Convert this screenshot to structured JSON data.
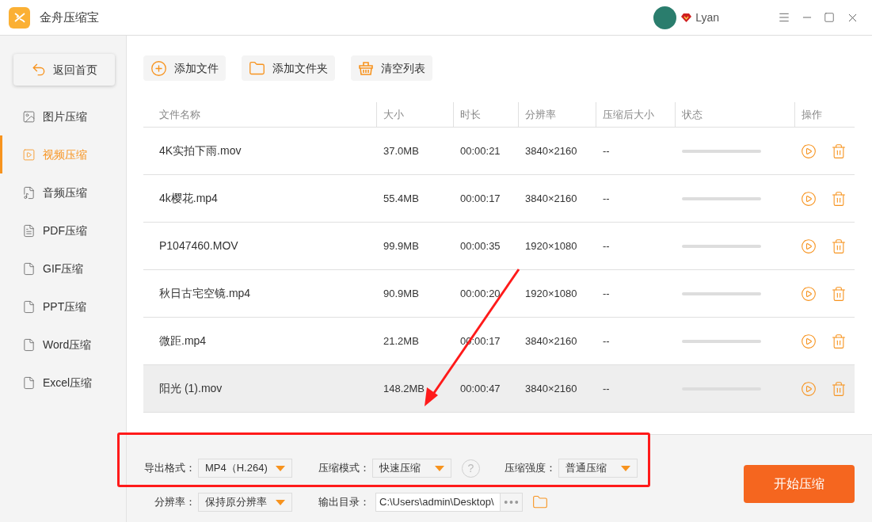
{
  "window": {
    "title": "金舟压缩宝",
    "user": "Lyan"
  },
  "sidebar": {
    "back_button": "返回首页",
    "items": [
      {
        "label": "图片压缩",
        "selected": false
      },
      {
        "label": "视频压缩",
        "selected": true
      },
      {
        "label": "音频压缩",
        "selected": false
      },
      {
        "label": "PDF压缩",
        "selected": false
      },
      {
        "label": "GIF压缩",
        "selected": false
      },
      {
        "label": "PPT压缩",
        "selected": false
      },
      {
        "label": "Word压缩",
        "selected": false
      },
      {
        "label": "Excel压缩",
        "selected": false
      }
    ]
  },
  "toolbar": [
    "添加文件",
    "添加文件夹",
    "清空列表"
  ],
  "table": {
    "columns": [
      "文件名称",
      "大小",
      "时长",
      "分辨率",
      "压缩后大小",
      "状态",
      "操作"
    ],
    "rows": [
      {
        "name": "4K实拍下雨.mov",
        "size": "37.0MB",
        "duration": "00:00:21",
        "resolution": "3840×2160",
        "compressed_size": "--",
        "selected": false
      },
      {
        "name": "4k樱花.mp4",
        "size": "55.4MB",
        "duration": "00:00:17",
        "resolution": "3840×2160",
        "compressed_size": "--",
        "selected": false
      },
      {
        "name": "P1047460.MOV",
        "size": "99.9MB",
        "duration": "00:00:35",
        "resolution": "1920×1080",
        "compressed_size": "--",
        "selected": false
      },
      {
        "name": "秋日古宅空镜.mp4",
        "size": "90.9MB",
        "duration": "00:00:20",
        "resolution": "1920×1080",
        "compressed_size": "--",
        "selected": false
      },
      {
        "name": "微距.mp4",
        "size": "21.2MB",
        "duration": "00:00:17",
        "resolution": "3840×2160",
        "compressed_size": "--",
        "selected": false
      },
      {
        "name": "阳光 (1).mov",
        "size": "148.2MB",
        "duration": "00:00:47",
        "resolution": "3840×2160",
        "compressed_size": "--",
        "selected": true
      }
    ]
  },
  "settings": [
    [
      {
        "kind": "dropdown",
        "label": "导出格式：",
        "value": "MP4（H.264)"
      },
      {
        "kind": "dropdown",
        "label": "压缩模式：",
        "value": "快速压缩"
      },
      {
        "kind": "help",
        "text": "?"
      },
      {
        "kind": "dropdown",
        "label": "压缩强度：",
        "value": "普通压缩"
      }
    ],
    [
      {
        "kind": "dropdown",
        "label": "分辨率：",
        "value": "保持原分辨率"
      },
      {
        "kind": "path",
        "label": "输出目录：",
        "value": "C:\\Users\\admin\\Desktop\\"
      }
    ]
  ],
  "start_button": "开始压缩",
  "annotations": {
    "highlight_box": true,
    "arrow": true
  }
}
